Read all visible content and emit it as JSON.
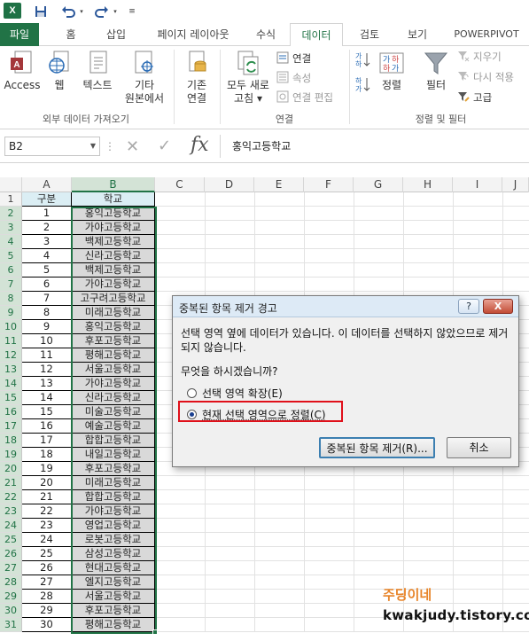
{
  "quick_access": {
    "logo": "X",
    "icons": [
      "excel-logo",
      "save-icon",
      "undo-icon",
      "redo-icon"
    ]
  },
  "tabs": [
    "파일",
    "홈",
    "삽입",
    "페이지 레이아웃",
    "수식",
    "데이터",
    "검토",
    "보기",
    "POWERPIVOT"
  ],
  "ribbon": {
    "external": {
      "access": "Access",
      "web": "웹",
      "text": "텍스트",
      "other1": "기타",
      "other2": "원본에서",
      "group_label": "외부 데이터 가져오기"
    },
    "existing": {
      "line1": "기존",
      "line2": "연결"
    },
    "connections": {
      "refresh1": "모두 새로",
      "refresh2": "고침",
      "connect": "연결",
      "properties": "속성",
      "edit_links": "연결 편집",
      "group_label": "연결"
    },
    "sort_filter": {
      "sort": "정렬",
      "filter": "필터",
      "clear": "지우기",
      "reapply": "다시 적용",
      "advanced": "고급",
      "group_label": "정렬 및 필터"
    }
  },
  "formula_bar": {
    "name_box": "B2",
    "formula": "홍익고등학교",
    "fx": "fx"
  },
  "columns": [
    "A",
    "B",
    "C",
    "D",
    "E",
    "F",
    "G",
    "H",
    "I",
    "J"
  ],
  "header_row": {
    "a": "구분",
    "b": "학교"
  },
  "rows": [
    {
      "n": "1",
      "b": "홍익고등학교"
    },
    {
      "n": "2",
      "b": "가야고등학교"
    },
    {
      "n": "3",
      "b": "백제고등학교"
    },
    {
      "n": "4",
      "b": "신라고등학교"
    },
    {
      "n": "5",
      "b": "백제고등학교"
    },
    {
      "n": "6",
      "b": "가야고등학교"
    },
    {
      "n": "7",
      "b": "고구려고등학교"
    },
    {
      "n": "8",
      "b": "미래고등학교"
    },
    {
      "n": "9",
      "b": "홍익고등학교"
    },
    {
      "n": "10",
      "b": "후포고등학교"
    },
    {
      "n": "11",
      "b": "평해고등학교"
    },
    {
      "n": "12",
      "b": "서울고등학교"
    },
    {
      "n": "13",
      "b": "가야고등학교"
    },
    {
      "n": "14",
      "b": "신라고등학교"
    },
    {
      "n": "15",
      "b": "미술고등학교"
    },
    {
      "n": "16",
      "b": "예술고등학교"
    },
    {
      "n": "17",
      "b": "합합고등학교"
    },
    {
      "n": "18",
      "b": "내일고등학교"
    },
    {
      "n": "19",
      "b": "후포고등학교"
    },
    {
      "n": "20",
      "b": "미래고등학교"
    },
    {
      "n": "21",
      "b": "합합고등학교"
    },
    {
      "n": "22",
      "b": "가야고등학교"
    },
    {
      "n": "23",
      "b": "영업고등학교"
    },
    {
      "n": "24",
      "b": "로봇고등학교"
    },
    {
      "n": "25",
      "b": "삼성고등학교"
    },
    {
      "n": "26",
      "b": "현대고등학교"
    },
    {
      "n": "27",
      "b": "엘지고등학교"
    },
    {
      "n": "28",
      "b": "서울고등학교"
    },
    {
      "n": "29",
      "b": "후포고등학교"
    },
    {
      "n": "30",
      "b": "평해고등학교"
    }
  ],
  "dialog": {
    "title": "중복된 항목 제거 경고",
    "help": "?",
    "close": "X",
    "message": "선택 영역 옆에 데이터가 있습니다. 이 데이터를 선택하지 않았으므로 제거되지 않습니다.",
    "question": "무엇을 하시겠습니까?",
    "option_expand": "선택 영역 확장(E)",
    "option_current": "현재 선택 영역으로 정렬(C)",
    "selected": "option_current",
    "btn_remove": "중복된 항목 제거(R)...",
    "btn_cancel": "취소"
  },
  "watermark": {
    "name": "주딩이네",
    "url": "kwakjudy.tistory.com"
  },
  "colors": {
    "excel_green": "#217346",
    "selection_gray": "#d9d9d9",
    "header_fill": "#dbeef4",
    "highlight_red": "#e0101a"
  }
}
